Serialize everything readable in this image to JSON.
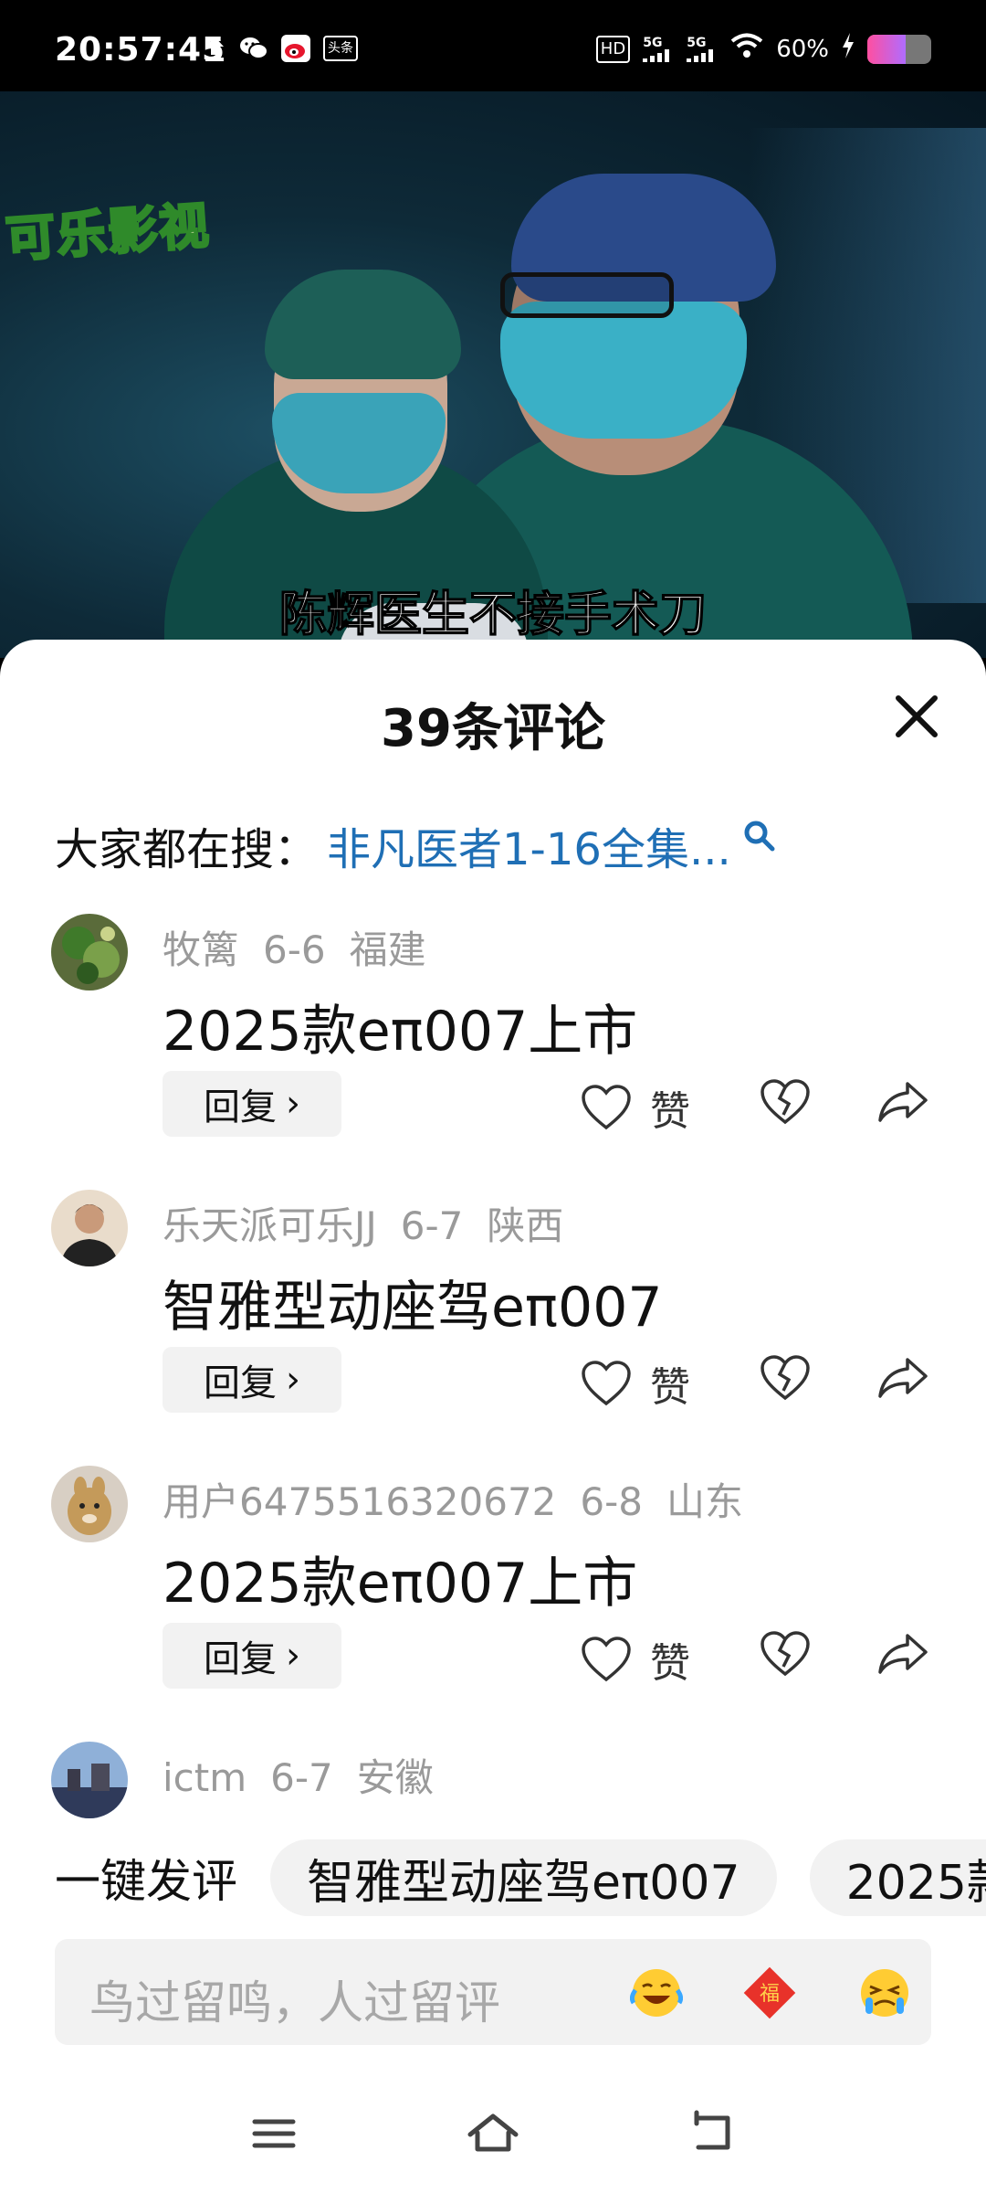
{
  "status_bar": {
    "time": "20:57:45",
    "left_icons": [
      "upload-icon",
      "wechat-icon",
      "weibo-icon",
      "toutiao-icon"
    ],
    "toutiao_label": "头条",
    "hd_label": "HD",
    "net1": "5G",
    "net2": "5G",
    "battery": "60%",
    "battery_level": 60
  },
  "video": {
    "logo": "可乐影视",
    "subtitle": "陈辉医生不接手术刀"
  },
  "sheet": {
    "title": "39条评论",
    "search_prefix": "大家都在搜：",
    "search_hot": "非凡医者1-16全集..."
  },
  "comments": [
    {
      "user": "牧篱",
      "date": "6-6",
      "region": "福建",
      "text": "2025款eπ007上市",
      "reply": "回复",
      "like": "赞"
    },
    {
      "user": "乐天派可乐JJ",
      "date": "6-7",
      "region": "陕西",
      "text": "智雅型动座驾eπ007",
      "reply": "回复",
      "like": "赞"
    },
    {
      "user": "用户6475516320672",
      "date": "6-8",
      "region": "山东",
      "text": "2025款eπ007上市",
      "reply": "回复",
      "like": "赞"
    },
    {
      "user": "ictm",
      "date": "6-7",
      "region": "安徽"
    }
  ],
  "quick_reply": {
    "label": "一键发评",
    "chips": [
      "智雅型动座驾eπ007",
      "2025款"
    ]
  },
  "input": {
    "placeholder": "鸟过留鸣，人过留评",
    "emojis": [
      "laughing-crying-emoji",
      "fu-emoji",
      "crying-emoji"
    ],
    "fu_char": "福"
  },
  "colors": {
    "accent_link": "#1f6fb5",
    "meta_gray": "#9a9a9a"
  }
}
